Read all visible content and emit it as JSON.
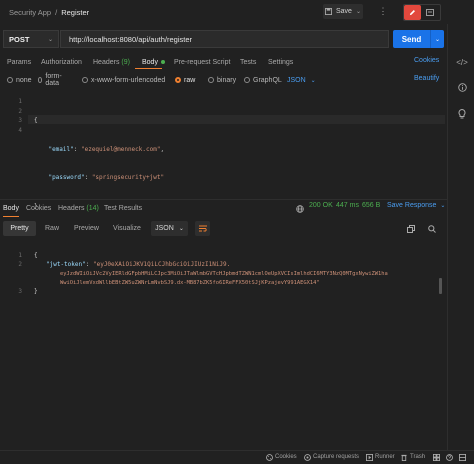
{
  "breadcrumb": {
    "collection": "Security App",
    "separator": "/",
    "request": "Register"
  },
  "toolbar": {
    "save_label": "Save"
  },
  "request": {
    "method": "POST",
    "url": "http://localhost:8080/api/auth/register",
    "send_label": "Send"
  },
  "request_tabs": {
    "params": "Params",
    "authorization": "Authorization",
    "headers": "Headers",
    "headers_count": "(9)",
    "body": "Body",
    "pre_request": "Pre-request Script",
    "tests": "Tests",
    "settings": "Settings",
    "cookies": "Cookies"
  },
  "body_types": {
    "none": "none",
    "form_data": "form-data",
    "urlencoded": "x-www-form-urlencoded",
    "raw": "raw",
    "binary": "binary",
    "graphql": "GraphQL",
    "format": "JSON",
    "beautify": "Beautify"
  },
  "request_body": {
    "line_numbers": [
      "1",
      "2",
      "3",
      "4"
    ],
    "open_brace": "{",
    "email_key": "\"email\"",
    "email_value": "\"ezequiel@menneck.com\"",
    "password_key": "\"password\"",
    "password_value": "\"springsecurity+jwt\"",
    "close_brace": "}"
  },
  "response_tabs": {
    "body": "Body",
    "cookies": "Cookies",
    "headers": "Headers",
    "headers_count": "(14)",
    "test_results": "Test Results"
  },
  "response_status": {
    "status": "200 OK",
    "time": "447 ms",
    "size": "656 B",
    "save_response": "Save Response"
  },
  "response_view": {
    "pretty": "Pretty",
    "raw": "Raw",
    "preview": "Preview",
    "visualize": "Visualize",
    "format": "JSON"
  },
  "response_body": {
    "line_numbers": [
      "1",
      "2",
      "3"
    ],
    "open_brace": "{",
    "token_key": "\"jwt-token\"",
    "token_line_1": "\"eyJ0eXAiOiJKV1QiLCJhbGciOiJIUzI1NiJ9.",
    "token_line_2": "eyJzdWIiOiJVc2VyIERldGFpbHMiLCJpc3MiOiJTaWlmbGVTcHJpbmdTZWN1cmlOeUpXVCIsImlhdCI6MTY3NzQ0MTgxNywiZW1ha",
    "token_line_3": "WwiOiJlemVxdWllbEBtZW5uZWNrLmNvbSJ9.dx-MB87bZK5fo6IReFFX50tSJjKPzajevY991AEGX14\"",
    "close_brace": "}"
  },
  "status_bar": {
    "cookies": "Cookies",
    "capture": "Capture requests",
    "runner": "Runner",
    "trash": "Trash"
  },
  "colors": {
    "accent": "#1a73e8",
    "orange": "#f08030",
    "green": "#4caf50",
    "key": "#9cdcfe",
    "string": "#ce9178"
  }
}
